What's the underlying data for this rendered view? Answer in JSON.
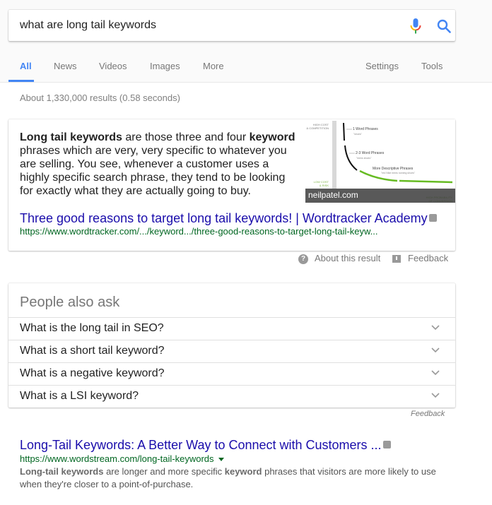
{
  "search": {
    "query": "what are long tail keywords",
    "mic_icon": "microphone-icon",
    "search_icon": "search-icon"
  },
  "tabs": {
    "items": [
      {
        "label": "All",
        "active": true
      },
      {
        "label": "News",
        "active": false
      },
      {
        "label": "Videos",
        "active": false
      },
      {
        "label": "Images",
        "active": false
      },
      {
        "label": "More",
        "active": false
      }
    ],
    "settings": "Settings",
    "tools": "Tools",
    "accent_color": "#4285f4"
  },
  "stats": "About 1,330,000 results (0.58 seconds)",
  "featured_snippet": {
    "text_bold_1": "Long tail keywords",
    "text_1": " are those three and four ",
    "text_bold_2": "keyword",
    "text_2": " phrases which are very, very specific to whatever you are selling. You see, whenever a customer uses a highly specific search phrase, they tend to be looking for exactly what they are actually going to buy.",
    "image": {
      "caption": "neilpatel.com",
      "top_left_label": [
        "HIGH COST",
        "& COMPETITION"
      ],
      "bottom_left_label": [
        "LOW COST",
        "& RISK"
      ],
      "phrase_1": "1 Word Phrases",
      "phrase_1_example": "\"shoes\"",
      "phrase_2": "2-3 Word Phrases",
      "phrase_2_example": "\"mens shoes\"",
      "phrase_3": "More Descriptive Phrases",
      "phrase_3_example": "\"red Nike mens running shoes\"",
      "bottom_right_label": [
        "HIGH PROBABILITY",
        "OF CONVERSION"
      ]
    },
    "title": "Three good reasons to target long tail keywords! | Wordtracker Academy",
    "url": "https://www.wordtracker.com/.../keyword.../three-good-reasons-to-target-long-tail-keyw...",
    "about_label": "About this result",
    "feedback_label": "Feedback"
  },
  "people_also_ask": {
    "heading": "People also ask",
    "questions": [
      "What is the long tail in SEO?",
      "What is a short tail keyword?",
      "What is a negative keyword?",
      "What is a LSI keyword?"
    ],
    "feedback_label": "Feedback"
  },
  "results": [
    {
      "title": "Long-Tail Keywords: A Better Way to Connect with Customers ...",
      "url": "https://www.wordstream.com/long-tail-keywords",
      "desc_bold_1": "Long-tail keywords",
      "desc_1": " are longer and more specific ",
      "desc_bold_2": "keyword",
      "desc_2": " phrases that visitors are more likely to use when they're closer to a point-of-purchase."
    }
  ],
  "colors": {
    "link": "#1a0dab",
    "url": "#006621",
    "header_bg": "#fafafa"
  }
}
